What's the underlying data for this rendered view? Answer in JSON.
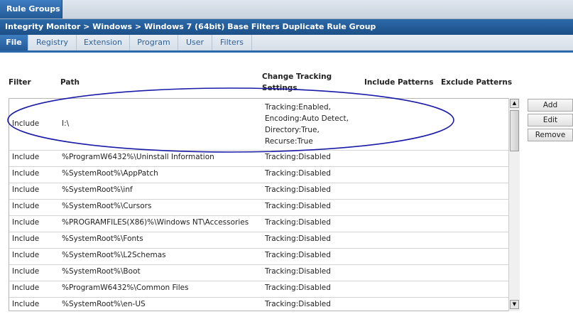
{
  "top_tab": {
    "label": "Rule Groups"
  },
  "breadcrumb": "Integrity Monitor > Windows > Windows 7 (64bit) Base Filters Duplicate Rule Group",
  "tabs": [
    {
      "label": "File"
    },
    {
      "label": "Registry"
    },
    {
      "label": "Extension"
    },
    {
      "label": "Program"
    },
    {
      "label": "User"
    },
    {
      "label": "Filters"
    }
  ],
  "columns": {
    "filter": "Filter",
    "path": "Path",
    "change_tracking_1": "Change Tracking",
    "change_tracking_2": "Settings",
    "include_patterns": "Include Patterns",
    "exclude_patterns": "Exclude Patterns"
  },
  "first_row": {
    "filter": "Include",
    "path": "I:\\",
    "settings": [
      "Tracking:Enabled,",
      "Encoding:Auto Detect,",
      "Directory:True,",
      "Recurse:True"
    ]
  },
  "rows": [
    {
      "filter": "Include",
      "path": "%ProgramW6432%\\Uninstall Information",
      "settings": "Tracking:Disabled"
    },
    {
      "filter": "Include",
      "path": "%SystemRoot%\\AppPatch",
      "settings": "Tracking:Disabled"
    },
    {
      "filter": "Include",
      "path": "%SystemRoot%\\inf",
      "settings": "Tracking:Disabled"
    },
    {
      "filter": "Include",
      "path": "%SystemRoot%\\Cursors",
      "settings": "Tracking:Disabled"
    },
    {
      "filter": "Include",
      "path": "%PROGRAMFILES(X86)%\\Windows NT\\Accessories",
      "settings": "Tracking:Disabled"
    },
    {
      "filter": "Include",
      "path": "%SystemRoot%\\Fonts",
      "settings": "Tracking:Disabled"
    },
    {
      "filter": "Include",
      "path": "%SystemRoot%\\L2Schemas",
      "settings": "Tracking:Disabled"
    },
    {
      "filter": "Include",
      "path": "%SystemRoot%\\Boot",
      "settings": "Tracking:Disabled"
    },
    {
      "filter": "Include",
      "path": "%ProgramW6432%\\Common Files",
      "settings": "Tracking:Disabled"
    },
    {
      "filter": "Include",
      "path": "%SystemRoot%\\en-US",
      "settings": "Tracking:Disabled"
    }
  ],
  "buttons": {
    "add": "Add",
    "edit": "Edit",
    "remove": "Remove"
  },
  "icons": {
    "scroll_up": "scroll-up-arrow-icon",
    "scroll_down": "scroll-down-arrow-icon"
  },
  "colors": {
    "header_blue": "#2b69a9",
    "tab_text": "#2d5f96",
    "highlight_oval": "#1a1aa8"
  }
}
